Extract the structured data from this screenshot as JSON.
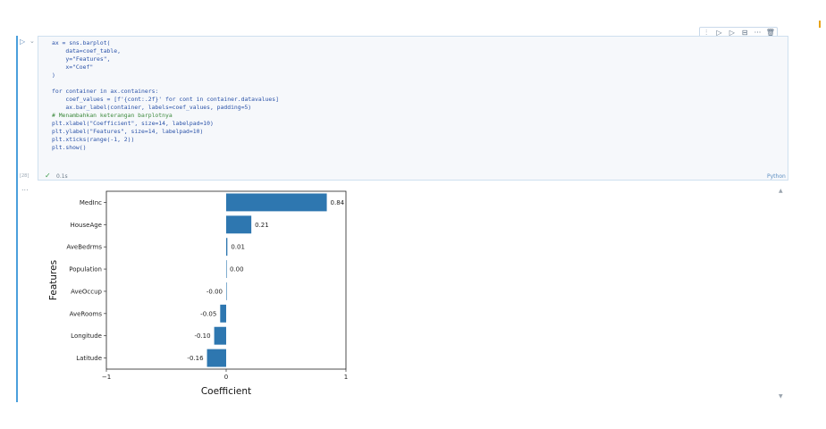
{
  "toolbar": {
    "icons": [
      "run-by-line-icon",
      "execute-above-icon",
      "execute-below-icon",
      "split-cell-icon",
      "more-icon",
      "delete-icon"
    ],
    "glyphs": [
      "⫶",
      "▷",
      "▷",
      "⊟",
      "···",
      "🗑"
    ]
  },
  "cell": {
    "run_glyph": "▷",
    "dropdown_glyph": "⌄",
    "code_lines": [
      "ax = sns.barplot(",
      "    data=coef_table,",
      "    y=\"Features\",",
      "    x=\"Coef\"",
      ")",
      "",
      "for container in ax.containers:",
      "    coef_values = [f'{cont:.2f}' for cont in container.datavalues]",
      "    ax.bar_label(container, labels=coef_values, padding=5)",
      "# Menambahkan keterangan barplotnya",
      "plt.xlabel(\"Coefficient\", size=14, labelpad=10)",
      "plt.ylabel(\"Features\", size=14, labelpad=10)",
      "plt.xticks(range(-1, 2))",
      "plt.show()"
    ],
    "execution_count": "[28]",
    "status_glyph": "✓",
    "exec_time": "0.1s",
    "language": "Python"
  },
  "output": {
    "menu_glyph": "...",
    "scroll_up_glyph": "▲",
    "scroll_down_glyph": "▼"
  },
  "chart_data": {
    "type": "bar",
    "orientation": "horizontal",
    "categories": [
      "MedInc",
      "HouseAge",
      "AveBedrms",
      "Population",
      "AveOccup",
      "AveRooms",
      "Longitude",
      "Latitude"
    ],
    "values": [
      0.84,
      0.21,
      0.01,
      0.0,
      -0.0,
      -0.05,
      -0.1,
      -0.16
    ],
    "data_labels": [
      "0.84",
      "0.21",
      "0.01",
      "0.00",
      "-0.00",
      "-0.05",
      "-0.10",
      "-0.16"
    ],
    "xlabel": "Coefficient",
    "ylabel": "Features",
    "xlim": [
      -1,
      1
    ],
    "xticks": [
      -1,
      0,
      1
    ],
    "xtick_labels": [
      "−1",
      "0",
      "1"
    ],
    "grid": false,
    "bar_color": "#2e77b0"
  }
}
